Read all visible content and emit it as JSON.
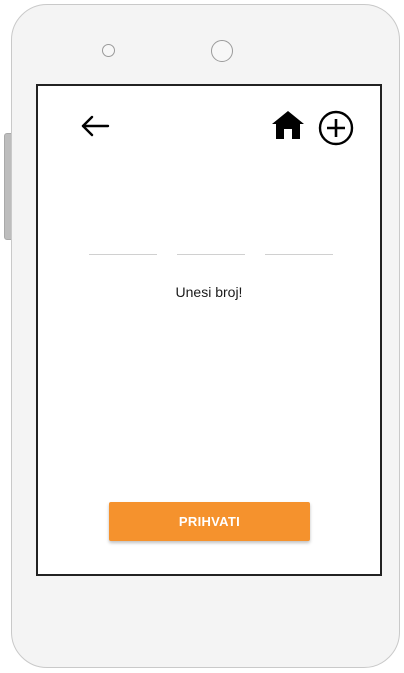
{
  "toolbar": {
    "back_icon": "arrow-left-icon",
    "home_icon": "home-icon",
    "add_icon": "circle-plus-icon"
  },
  "code_entry": {
    "digit_fields": 3,
    "prompt": "Unesi broj!"
  },
  "actions": {
    "accept_label": "PRIHVATI"
  },
  "colors": {
    "accent": "#f5922d",
    "screen_border": "#222222",
    "device_body": "#f4f4f4"
  }
}
